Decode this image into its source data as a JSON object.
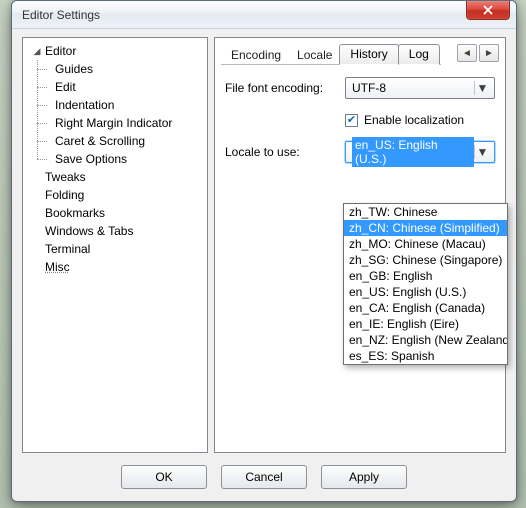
{
  "window": {
    "title": "Editor Settings"
  },
  "tree": {
    "root": [
      {
        "label": "Editor",
        "expanded": true,
        "children": [
          {
            "label": "Guides"
          },
          {
            "label": "Edit"
          },
          {
            "label": "Indentation"
          },
          {
            "label": "Right Margin Indicator"
          },
          {
            "label": "Caret & Scrolling"
          },
          {
            "label": "Save Options"
          }
        ]
      },
      {
        "label": "Tweaks",
        "expanded": false
      },
      {
        "label": "Folding"
      },
      {
        "label": "Bookmarks"
      },
      {
        "label": "Windows & Tabs"
      },
      {
        "label": "Terminal"
      },
      {
        "label": "Misc",
        "hovered": true
      }
    ]
  },
  "tabs": {
    "flat": [
      "Encoding",
      "Locale"
    ],
    "buttons": [
      "History",
      "Log"
    ]
  },
  "form": {
    "encoding_label": "File font encoding:",
    "encoding_value": "UTF-8",
    "enable_localization_label": "Enable localization",
    "enable_localization_checked": true,
    "locale_label": "Locale to use:",
    "locale_value": "en_US: English (U.S.)"
  },
  "locale_options": [
    {
      "label": "zh_TW: Chinese",
      "selected": false
    },
    {
      "label": "zh_CN: Chinese (Simplified)",
      "selected": true
    },
    {
      "label": "zh_MO: Chinese (Macau)",
      "selected": false
    },
    {
      "label": "zh_SG: Chinese (Singapore)",
      "selected": false
    },
    {
      "label": "en_GB: English",
      "selected": false
    },
    {
      "label": "en_US: English (U.S.)",
      "selected": false
    },
    {
      "label": "en_CA: English (Canada)",
      "selected": false
    },
    {
      "label": "en_IE: English (Eire)",
      "selected": false
    },
    {
      "label": "en_NZ: English (New Zealand)",
      "selected": false
    },
    {
      "label": "es_ES: Spanish",
      "selected": false
    }
  ],
  "buttons": {
    "ok": "OK",
    "cancel": "Cancel",
    "apply": "Apply"
  },
  "nav": {
    "prev": "◄",
    "next": "►"
  }
}
